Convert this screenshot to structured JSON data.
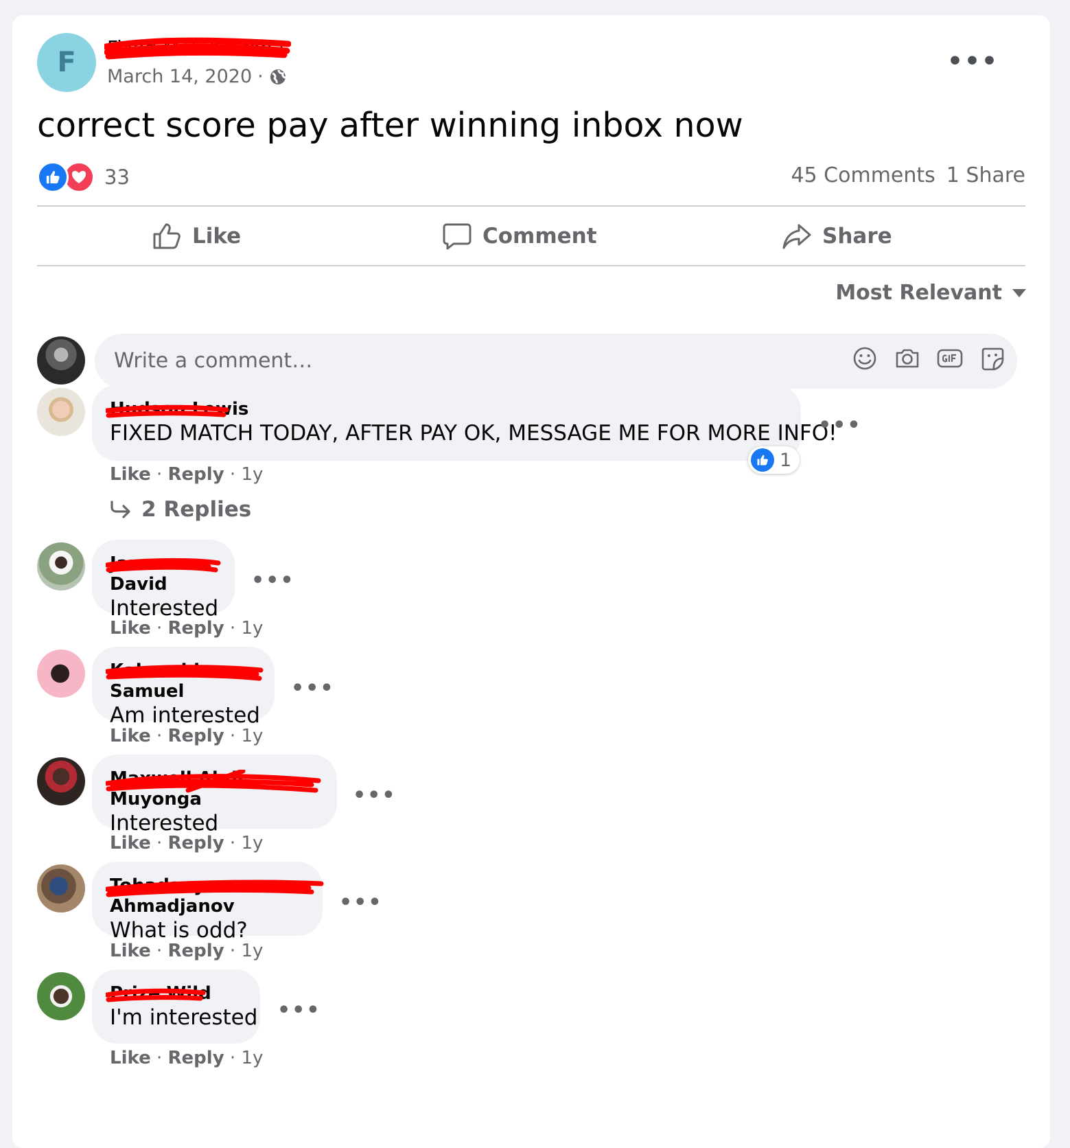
{
  "post": {
    "avatar_letter": "F",
    "author": "Fixed Match Arena",
    "date": "March 14, 2020",
    "separator": "·",
    "text": "correct score pay after winning inbox now",
    "reaction_count": "33",
    "comments_count": "45 Comments",
    "shares_count": "1 Share"
  },
  "actions": {
    "like": "Like",
    "comment": "Comment",
    "share": "Share"
  },
  "sort_label": "Most Relevant",
  "composer": {
    "placeholder": "Write a comment…",
    "icons": [
      "emoji-icon",
      "camera-icon",
      "gif-icon",
      "sticker-icon"
    ]
  },
  "comment_actions": {
    "like": "Like",
    "reply": "Reply",
    "dot": "·"
  },
  "comments": [
    {
      "author": "Hudson Lewis",
      "text": "FIXED MATCH TODAY, AFTER PAY OK, MESSAGE ME FOR MORE INFO!",
      "time": "1y",
      "reactions": "1",
      "replies": "2 Replies"
    },
    {
      "author": "James David",
      "text": "Interested",
      "time": "1y"
    },
    {
      "author": "Kalwechi Samuel",
      "text": "Am interested",
      "time": "1y"
    },
    {
      "author": "Maxwell Abdi Muyonga",
      "text": "Interested",
      "time": "1y"
    },
    {
      "author": "Tohadaey Ahmadjanov",
      "text": "What is odd?",
      "time": "1y"
    },
    {
      "author": "Prize Wild",
      "text": "I'm interested",
      "time": "1y"
    }
  ],
  "colors": {
    "accent": "#1877f2",
    "love": "#f33e58",
    "muted_text": "#65676b",
    "bubble": "#f0f2f5",
    "redaction": "#ff0000"
  }
}
